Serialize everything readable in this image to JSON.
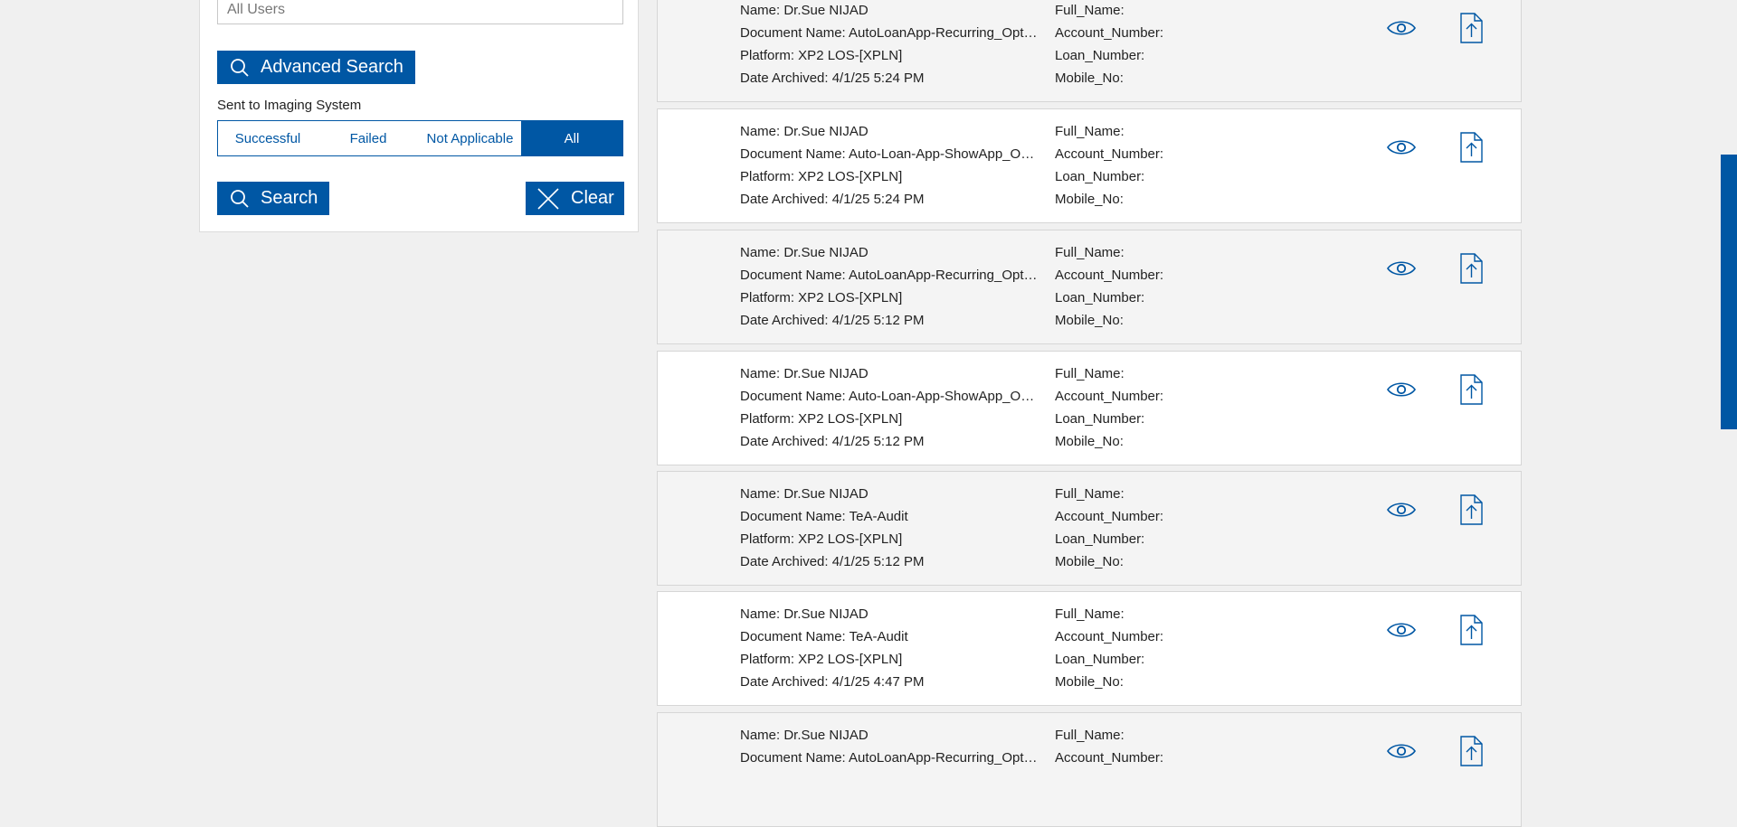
{
  "filter": {
    "user_value": "",
    "user_placeholder": "All Users",
    "advanced_search_label": "Advanced Search",
    "imaging_label": "Sent to Imaging System",
    "imaging_options": [
      "Successful",
      "Failed",
      "Not Applicable",
      "All"
    ],
    "imaging_selected": "All",
    "search_label": "Search",
    "clear_label": "Clear"
  },
  "results": [
    {
      "name": "Name: Dr.Sue NIJAD",
      "document": "Document Name: AutoLoanApp-Recurring_Optional_Disclosures",
      "platform": "Platform: XP2 LOS-[XPLN]",
      "date": "Date Archived: 4/1/25 5:24 PM",
      "full_name": "Full_Name:",
      "account": "Account_Number:",
      "loan": "Loan_Number:",
      "mobile": "Mobile_No:"
    },
    {
      "name": "Name: Dr.Sue NIJAD",
      "document": "Document Name: Auto-Loan-App-ShowApp_Optional_Disclosures",
      "platform": "Platform: XP2 LOS-[XPLN]",
      "date": "Date Archived: 4/1/25 5:24 PM",
      "full_name": "Full_Name:",
      "account": "Account_Number:",
      "loan": "Loan_Number:",
      "mobile": "Mobile_No:"
    },
    {
      "name": "Name: Dr.Sue NIJAD",
      "document": "Document Name: AutoLoanApp-Recurring_Optional_Disclosures",
      "platform": "Platform: XP2 LOS-[XPLN]",
      "date": "Date Archived: 4/1/25 5:12 PM",
      "full_name": "Full_Name:",
      "account": "Account_Number:",
      "loan": "Loan_Number:",
      "mobile": "Mobile_No:"
    },
    {
      "name": "Name: Dr.Sue NIJAD",
      "document": "Document Name: Auto-Loan-App-ShowApp_Optional_Disclosures",
      "platform": "Platform: XP2 LOS-[XPLN]",
      "date": "Date Archived: 4/1/25 5:12 PM",
      "full_name": "Full_Name:",
      "account": "Account_Number:",
      "loan": "Loan_Number:",
      "mobile": "Mobile_No:"
    },
    {
      "name": "Name: Dr.Sue NIJAD",
      "document": "Document Name: TeA-Audit",
      "platform": "Platform: XP2 LOS-[XPLN]",
      "date": "Date Archived: 4/1/25 5:12 PM",
      "full_name": "Full_Name:",
      "account": "Account_Number:",
      "loan": "Loan_Number:",
      "mobile": "Mobile_No:"
    },
    {
      "name": "Name: Dr.Sue NIJAD",
      "document": "Document Name: TeA-Audit",
      "platform": "Platform: XP2 LOS-[XPLN]",
      "date": "Date Archived: 4/1/25 4:47 PM",
      "full_name": "Full_Name:",
      "account": "Account_Number:",
      "loan": "Loan_Number:",
      "mobile": "Mobile_No:"
    },
    {
      "name": "Name: Dr.Sue NIJAD",
      "document": "Document Name: AutoLoanApp-Recurring_Optional_Disclosures",
      "platform": "",
      "date": "",
      "full_name": "Full_Name:",
      "account": "Account_Number:",
      "loan": "",
      "mobile": ""
    }
  ],
  "icons": {
    "view": "eye-icon",
    "upload": "file-upload-icon",
    "search": "search-icon",
    "clear": "close-icon"
  },
  "colors": {
    "accent": "#0057a4",
    "page_bg": "#f0f0f0",
    "row_alt_bg": "#f4f4f4"
  }
}
